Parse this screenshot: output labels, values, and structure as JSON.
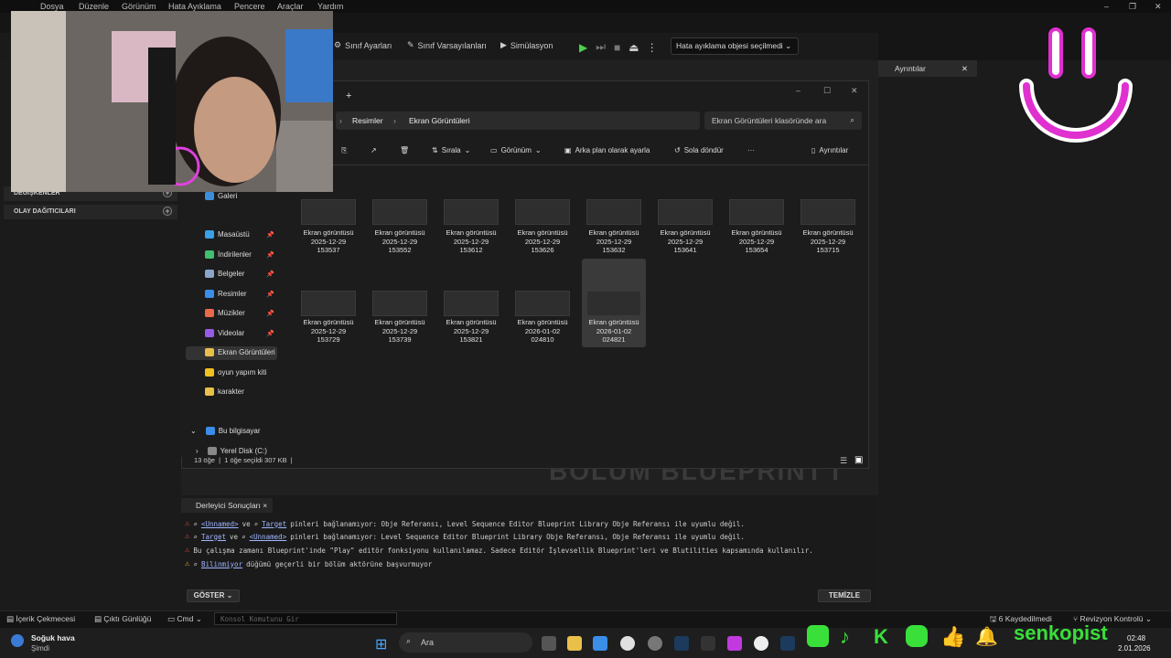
{
  "menu": [
    "Dosya",
    "Düzenle",
    "Görünüm",
    "Hata Ayıklama",
    "Pencere",
    "Araçlar",
    "Yardım"
  ],
  "window_controls": [
    "–",
    "❐",
    "✕"
  ],
  "toolbar": {
    "class_settings": "Sınıf Ayarları",
    "class_defaults": "Sınıf Varsayılanları",
    "simulation": "Simülasyon",
    "debug_object": "Hata ayıklama objesi seçilmedi"
  },
  "left_panel": {
    "variables": "DEĞİŞKENLER",
    "event_dispatchers": "OLAY DAĞITICILARI"
  },
  "details_tab": "Ayrıntılar",
  "background_heading": "BÖLÜM BLUEPRINT'İ",
  "explorer": {
    "breadcrumb": [
      "Resimler",
      "Ekran Görüntüleri"
    ],
    "search_placeholder": "Ekran Görüntüleri klasöründe ara",
    "commands": {
      "sort": "Sırala",
      "view": "Görünüm",
      "set_background": "Arka plan olarak ayarla",
      "rotate_left": "Sola döndür",
      "more": "···",
      "details": "Ayrıntılar"
    },
    "nav": [
      {
        "label": "Galeri",
        "pinned": false,
        "icon": "gallery-icon",
        "color": "#3b8fd8"
      },
      {
        "label": "Masaüstü",
        "pinned": true,
        "icon": "desktop-icon",
        "color": "#3aa0e8"
      },
      {
        "label": "İndirilenler",
        "pinned": true,
        "icon": "download-icon",
        "color": "#3fbf70"
      },
      {
        "label": "Belgeler",
        "pinned": true,
        "icon": "documents-icon",
        "color": "#8aa6c8"
      },
      {
        "label": "Resimler",
        "pinned": true,
        "icon": "pictures-icon",
        "color": "#3a8ee8"
      },
      {
        "label": "Müzikler",
        "pinned": true,
        "icon": "music-icon",
        "color": "#e86a4a"
      },
      {
        "label": "Videolar",
        "pinned": true,
        "icon": "videos-icon",
        "color": "#9a5ae8"
      },
      {
        "label": "Ekran Görüntüleri",
        "pinned": false,
        "icon": "folder-icon",
        "color": "#e8c04a"
      },
      {
        "label": "oyun yapım kiti",
        "pinned": false,
        "icon": "star-icon",
        "color": "#f0c020"
      },
      {
        "label": "karakter",
        "pinned": false,
        "icon": "folder-icon",
        "color": "#e8c04a"
      }
    ],
    "this_pc": "Bu bilgisayar",
    "local_disk": "Yerel Disk (C:)",
    "files": [
      {
        "name": "Ekran görüntüsü",
        "date": "2025-12-29",
        "time": "153537"
      },
      {
        "name": "Ekran görüntüsü",
        "date": "2025-12-29",
        "time": "153552"
      },
      {
        "name": "Ekran görüntüsü",
        "date": "2025-12-29",
        "time": "153612"
      },
      {
        "name": "Ekran görüntüsü",
        "date": "2025-12-29",
        "time": "153626"
      },
      {
        "name": "Ekran görüntüsü",
        "date": "2025-12-29",
        "time": "153632"
      },
      {
        "name": "Ekran görüntüsü",
        "date": "2025-12-29",
        "time": "153641"
      },
      {
        "name": "Ekran görüntüsü",
        "date": "2025-12-29",
        "time": "153654"
      },
      {
        "name": "Ekran görüntüsü",
        "date": "2025-12-29",
        "time": "153715"
      },
      {
        "name": "Ekran görüntüsü",
        "date": "2025-12-29",
        "time": "153729"
      },
      {
        "name": "Ekran görüntüsü",
        "date": "2025-12-29",
        "time": "153739"
      },
      {
        "name": "Ekran görüntüsü",
        "date": "2025-12-29",
        "time": "153821"
      },
      {
        "name": "Ekran görüntüsü",
        "date": "2026-01-02",
        "time": "024810"
      },
      {
        "name": "Ekran görüntüsü",
        "date": "2026-01-02",
        "time": "024821"
      }
    ],
    "status_count": "13 öğe",
    "status_selected": "1 öğe seçildi  307 KB"
  },
  "compiler": {
    "tab": "Derleyici Sonuçları",
    "messages": [
      {
        "a": "<Unnamed>",
        "mid": "ve",
        "b": "Target",
        "rest": "pinleri bağlanamıyor: Obje Referansı, Level Sequence Editor Blueprint Library Obje Referansı ile uyumlu değil.",
        "level": "error"
      },
      {
        "a": "Target",
        "mid": "ve",
        "b": "<Unnamed>",
        "rest": "pinleri bağlanamıyor: Level Sequence Editor Blueprint Library Obje Referansı, Obje Referansı ile uyumlu değil.",
        "level": "error"
      },
      {
        "a": "",
        "mid": "",
        "b": "",
        "rest": "Bu çalışma zamanı Blueprint'inde \"Play\" editör fonksiyonu kullanılamaz. Sadece Editör İşlevsellik Blueprint'leri ve Blutilities kapsamında kullanılır.",
        "level": "error"
      },
      {
        "a": "Bilinmiyor",
        "mid": "",
        "b": "",
        "rest": "düğümü geçerli bir bölüm aktörüne başvurmuyor",
        "level": "warning"
      }
    ],
    "show_button": "GÖSTER",
    "clear_button": "TEMİZLE"
  },
  "bottom_bar": {
    "content_drawer": "İçerik Çekmecesi",
    "output_log": "Çıktı Günlüğü",
    "cmd": "Cmd",
    "console_placeholder": "Konsol Komutunu Gir",
    "saved": "6 Kaydedilmedi",
    "revision": "Revizyon Kontrolü"
  },
  "taskbar": {
    "weather": "Soğuk hava",
    "weather_sub": "Şimdi",
    "search": "Ara",
    "time": "02:48",
    "date": "2.01.2026"
  },
  "overlay": {
    "channel": "senkopist"
  }
}
